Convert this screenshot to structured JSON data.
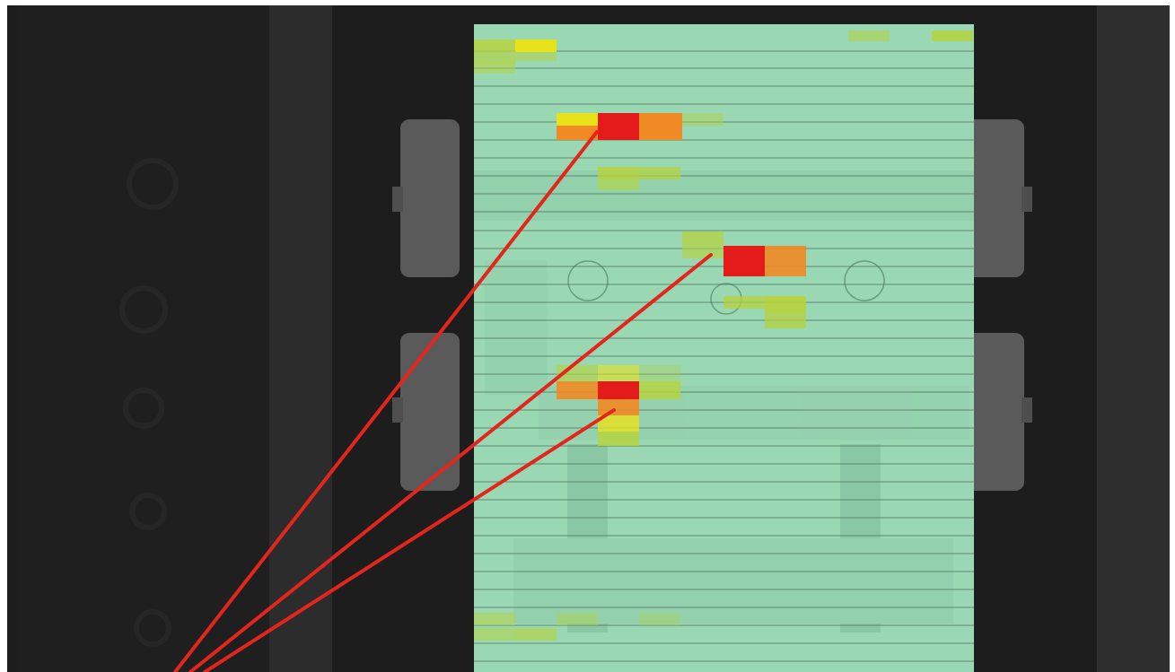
{
  "image": {
    "description_label": "",
    "colors": {
      "background_dark": "#1d1d1d",
      "panel_dark": "#2b2b2b",
      "frame_gray": "#4a4a4a",
      "overlay_green": "#9ad7b3",
      "heat_red": "#e31b1b",
      "heat_orange": "#f08a24",
      "heat_yellow": "#e7e21a",
      "heat_lime": "#b7d33a",
      "line_red": "#e3251c"
    },
    "heatmap_levels": [
      "low",
      "medium",
      "high",
      "peak"
    ]
  }
}
